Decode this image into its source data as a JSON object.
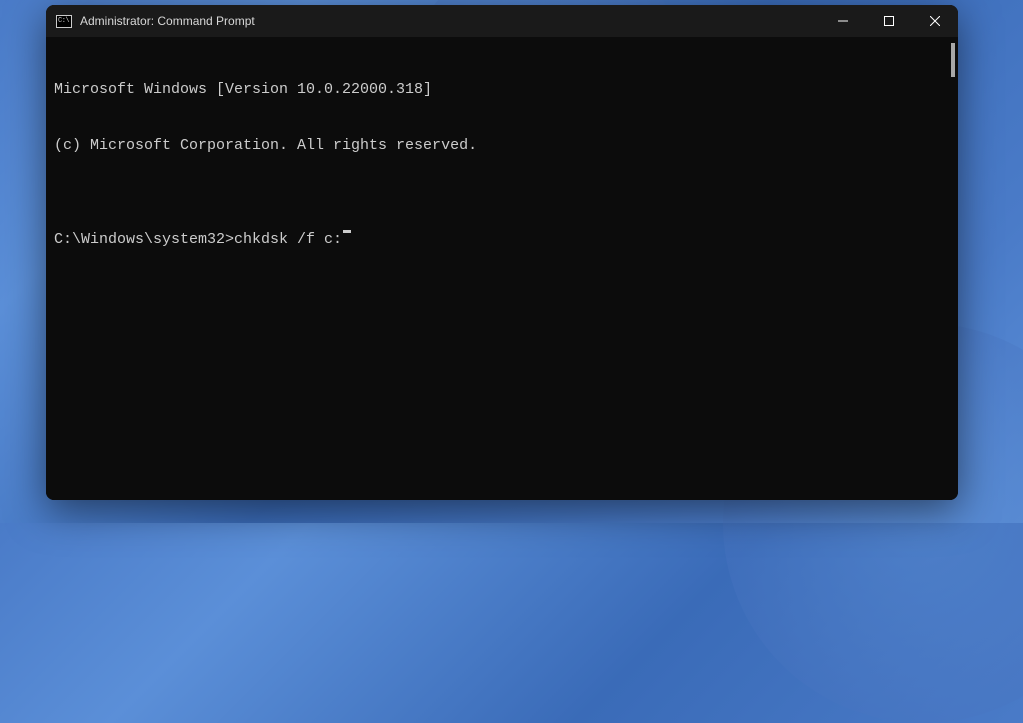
{
  "window": {
    "title": "Administrator: Command Prompt",
    "icon_text": "C:\\"
  },
  "terminal": {
    "line1": "Microsoft Windows [Version 10.0.22000.318]",
    "line2": "(c) Microsoft Corporation. All rights reserved.",
    "blank": "",
    "prompt": "C:\\Windows\\system32>",
    "command": "chkdsk /f c:"
  }
}
